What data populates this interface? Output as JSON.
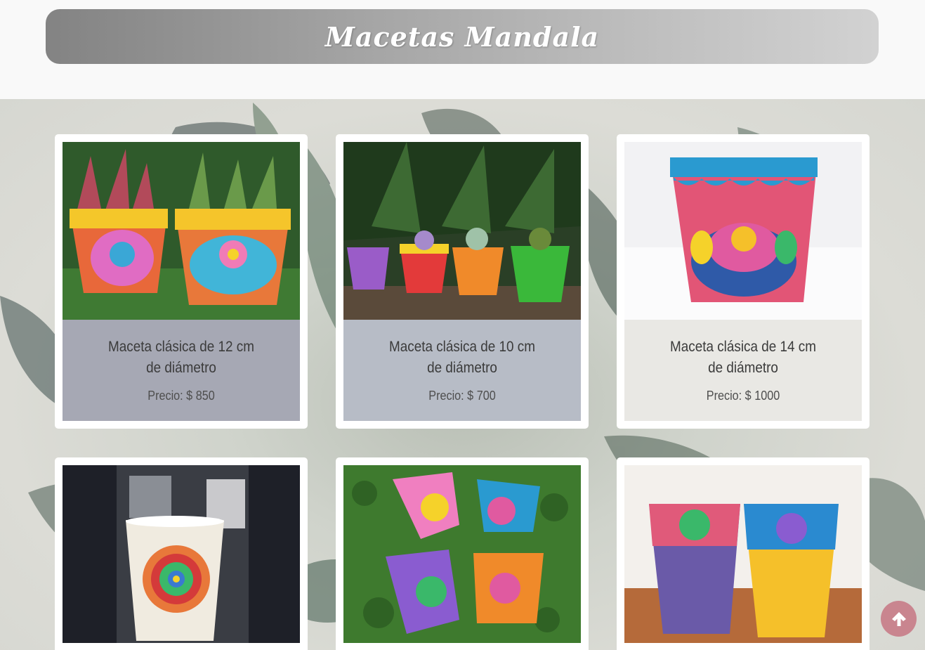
{
  "header": {
    "title": "Macetas Mandala"
  },
  "products": [
    {
      "name": "Maceta clásica de 12 cm de diámetro",
      "price": "Precio: $ 850"
    },
    {
      "name": "Maceta clásica de 10 cm de diámetro",
      "price": "Precio: $ 700"
    },
    {
      "name": "Maceta clásica de 14 cm de diámetro",
      "price": "Precio: $ 1000"
    }
  ],
  "colors": {
    "accent": "#c9858f",
    "title_gradient_start": "#838383",
    "title_gradient_end": "#d2d2d2"
  },
  "icons": {
    "scroll_top": "arrow-up-icon"
  }
}
